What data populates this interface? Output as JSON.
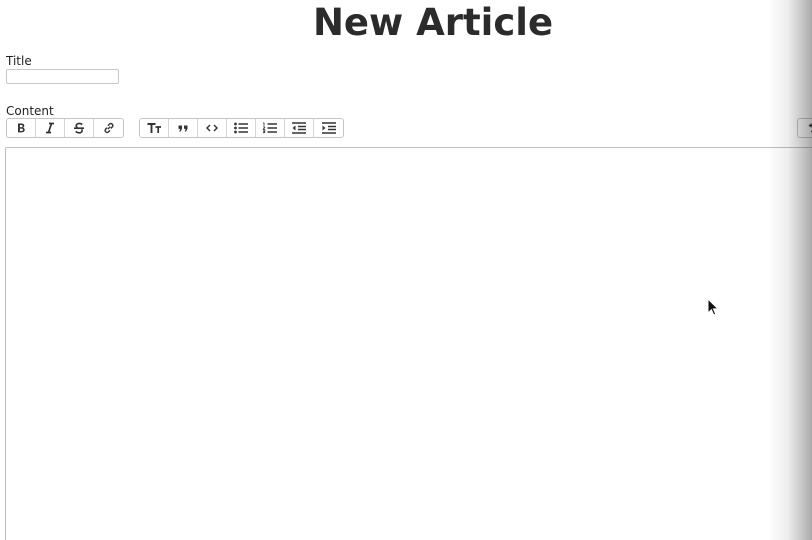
{
  "page": {
    "title": "New Article"
  },
  "form": {
    "title_label": "Title",
    "title_value": "",
    "content_label": "Content",
    "content_value": ""
  },
  "toolbar": {
    "text_group": [
      {
        "name": "bold",
        "icon": "bold-icon"
      },
      {
        "name": "italic",
        "icon": "italic-icon"
      },
      {
        "name": "strikethrough",
        "icon": "strikethrough-icon"
      },
      {
        "name": "link",
        "icon": "link-icon"
      }
    ],
    "block_group": [
      {
        "name": "heading",
        "icon": "heading-icon"
      },
      {
        "name": "quote",
        "icon": "quote-icon"
      },
      {
        "name": "code",
        "icon": "code-icon"
      },
      {
        "name": "bullet-list",
        "icon": "bullet-list-icon"
      },
      {
        "name": "numbered-list",
        "icon": "numbered-list-icon"
      },
      {
        "name": "decrease-indent",
        "icon": "outdent-icon"
      },
      {
        "name": "increase-indent",
        "icon": "indent-icon"
      }
    ],
    "history_group": [
      {
        "name": "undo",
        "icon": "undo-icon"
      }
    ]
  },
  "colors": {
    "title_text": "#2b2b2b",
    "border": "#c4c4c4",
    "icon": "#333333"
  }
}
